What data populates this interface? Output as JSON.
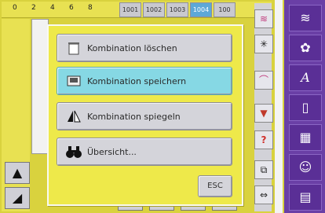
{
  "ruler": {
    "numbers": [
      "0",
      "2",
      "4",
      "6",
      "8"
    ]
  },
  "stitch_tabs": [
    "1001",
    "1002",
    "1003",
    "1004",
    "100"
  ],
  "dialog": {
    "items": [
      {
        "label": "Kombination löschen",
        "icon": "delete-combination-icon"
      },
      {
        "label": "Kombination speichern",
        "icon": "save-combination-icon"
      },
      {
        "label": "Kombination spiegeln",
        "icon": "mirror-combination-icon"
      },
      {
        "label": "Übersicht...",
        "icon": "binoculars-icon"
      }
    ],
    "esc_label": "ESC"
  },
  "left_rail_icons": [
    "needle-icon",
    "needle-left-icon"
  ],
  "function_icons": [
    "zigzag-icon",
    "needle-stop-icon",
    "mirror-icon",
    "arrow-down-icon",
    "help-icon",
    "layers-icon",
    "combination-icon"
  ],
  "help_label": "?",
  "purple_toolbar": [
    "stitch-pattern-icon",
    "decorative-icon",
    "alphabet-icon",
    "buttonhole-icon",
    "quilt-icon",
    "personal-program-icon",
    "memory-icon"
  ],
  "colors": {
    "screen_bg": "#d9d23e",
    "dialog_bg": "#eee94a",
    "highlight": "#86d8e4",
    "purple": "#6a3fa6"
  }
}
